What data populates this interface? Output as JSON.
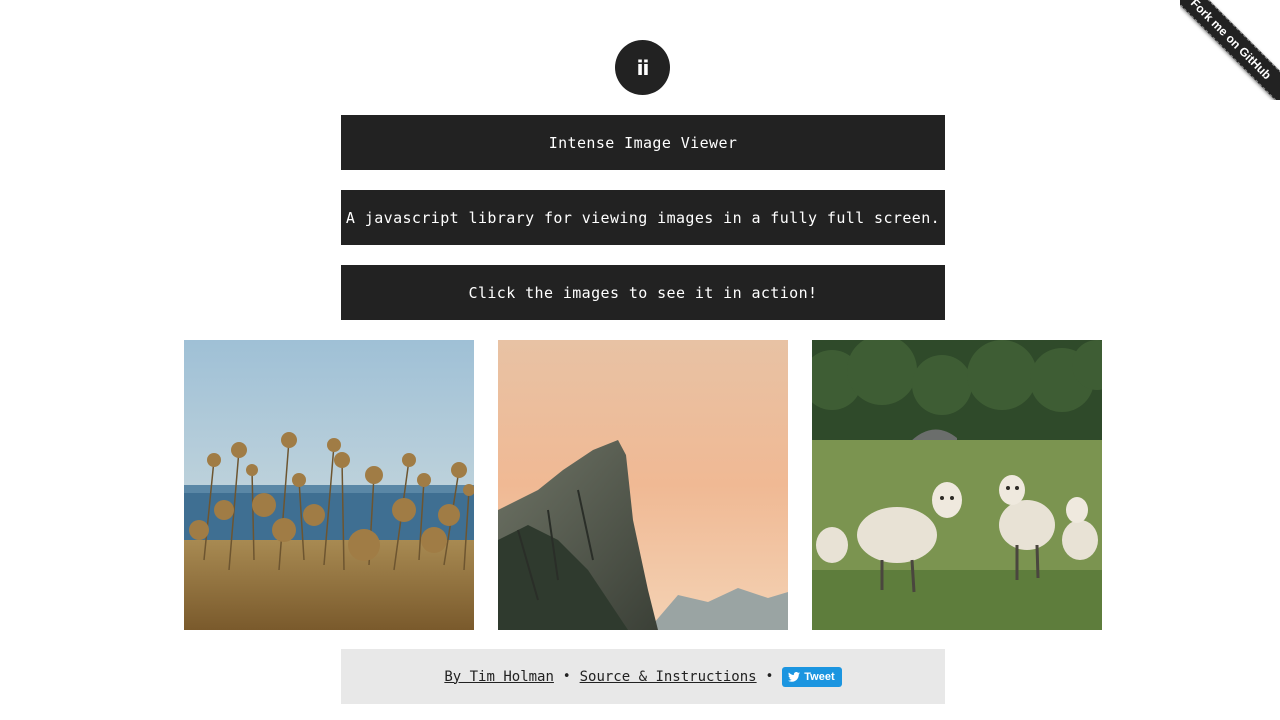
{
  "logo": {
    "text": "ii",
    "icon": "intense-logo-icon"
  },
  "header": {
    "title": "Intense Image Viewer",
    "subtitle": "A javascript library for viewing images in a fully full screen.",
    "cta": "Click the images to see it in action!"
  },
  "gallery": {
    "images": [
      {
        "subject": "dried flowers by the sea"
      },
      {
        "subject": "rocky mountain peak at sunset"
      },
      {
        "subject": "sheep in a green field"
      }
    ]
  },
  "footer": {
    "author_link": "By Tim Holman",
    "separator": "•",
    "source_link": "Source & Instructions",
    "tweet_label": "Tweet",
    "tweet_icon": "twitter-bird-icon"
  },
  "ribbon": {
    "label": "Fork me on GitHub"
  },
  "colors": {
    "dark": "#222222",
    "footer_bg": "#e8e8e8",
    "tweet_blue": "#1b95e0"
  }
}
